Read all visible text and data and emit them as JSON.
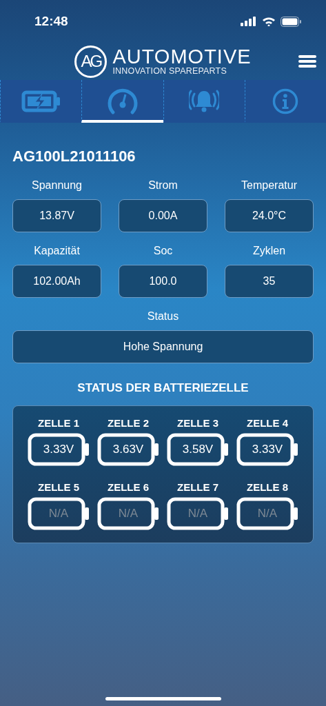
{
  "status_bar": {
    "time": "12:48"
  },
  "header": {
    "logo_mark": "AG",
    "brand": "AUTOMOTIVE",
    "tagline": "INNOVATION SPAREPARTS"
  },
  "tabs": [
    {
      "kind": "battery",
      "selected": false
    },
    {
      "kind": "gauge",
      "selected": true
    },
    {
      "kind": "bell",
      "selected": false
    },
    {
      "kind": "info",
      "selected": false
    }
  ],
  "device_id": "AG100L21011106",
  "metrics": [
    {
      "label": "Spannung",
      "value": "13.87V"
    },
    {
      "label": "Strom",
      "value": "0.00A"
    },
    {
      "label": "Temperatur",
      "value": "24.0°C"
    },
    {
      "label": "Kapazität",
      "value": "102.00Ah"
    },
    {
      "label": "Soc",
      "value": "100.0"
    },
    {
      "label": "Zyklen",
      "value": "35"
    }
  ],
  "status": {
    "label": "Status",
    "value": "Hohe Spannung"
  },
  "cells_title": "STATUS DER BATTERIEZELLE",
  "cells": [
    {
      "label": "ZELLE 1",
      "value": "3.33V",
      "available": true
    },
    {
      "label": "ZELLE 2",
      "value": "3.63V",
      "available": true
    },
    {
      "label": "ZELLE 3",
      "value": "3.58V",
      "available": true
    },
    {
      "label": "ZELLE 4",
      "value": "3.33V",
      "available": true
    },
    {
      "label": "ZELLE 5",
      "value": "N/A",
      "available": false
    },
    {
      "label": "ZELLE 6",
      "value": "N/A",
      "available": false
    },
    {
      "label": "ZELLE 7",
      "value": "N/A",
      "available": false
    },
    {
      "label": "ZELLE 8",
      "value": "N/A",
      "available": false
    }
  ]
}
